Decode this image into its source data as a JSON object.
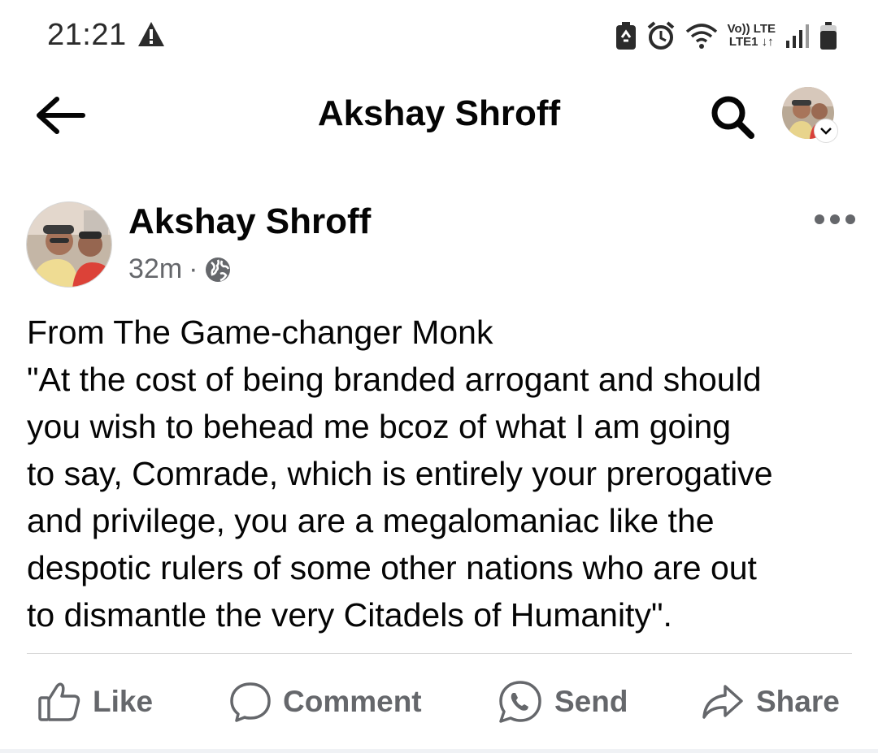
{
  "status_bar": {
    "time": "21:21",
    "net_line1": "Vo)) LTE",
    "net_line2": "LTE1 ↓↑",
    "icons": [
      "warning-icon",
      "battery-saver-icon",
      "alarm-icon",
      "wifi-icon",
      "signal-icon",
      "battery-icon"
    ]
  },
  "app_bar": {
    "title": "Akshay Shroff",
    "icons": [
      "back-arrow-icon",
      "search-icon",
      "profile-avatar",
      "chevron-down-icon"
    ]
  },
  "post": {
    "author": "Akshay Shroff",
    "time": "32m",
    "separator": "·",
    "privacy_icon": "globe-icon",
    "more_icon": "more-options-icon",
    "text_lines": [
      "From The Game-changer Monk",
      "\"At the cost of being branded arrogant and should",
      "you wish to behead me bcoz of what I am going",
      "to say, Comrade, which is entirely your prerogative",
      "and privilege, you are a megalomaniac like the",
      "despotic rulers of some other nations who are out",
      "to dismantle the very Citadels of Humanity\"."
    ]
  },
  "actions": {
    "like": "Like",
    "comment": "Comment",
    "send": "Send",
    "share": "Share"
  },
  "colors": {
    "text_primary": "#050505",
    "text_secondary": "#65676b",
    "divider": "#d9d9d9"
  }
}
